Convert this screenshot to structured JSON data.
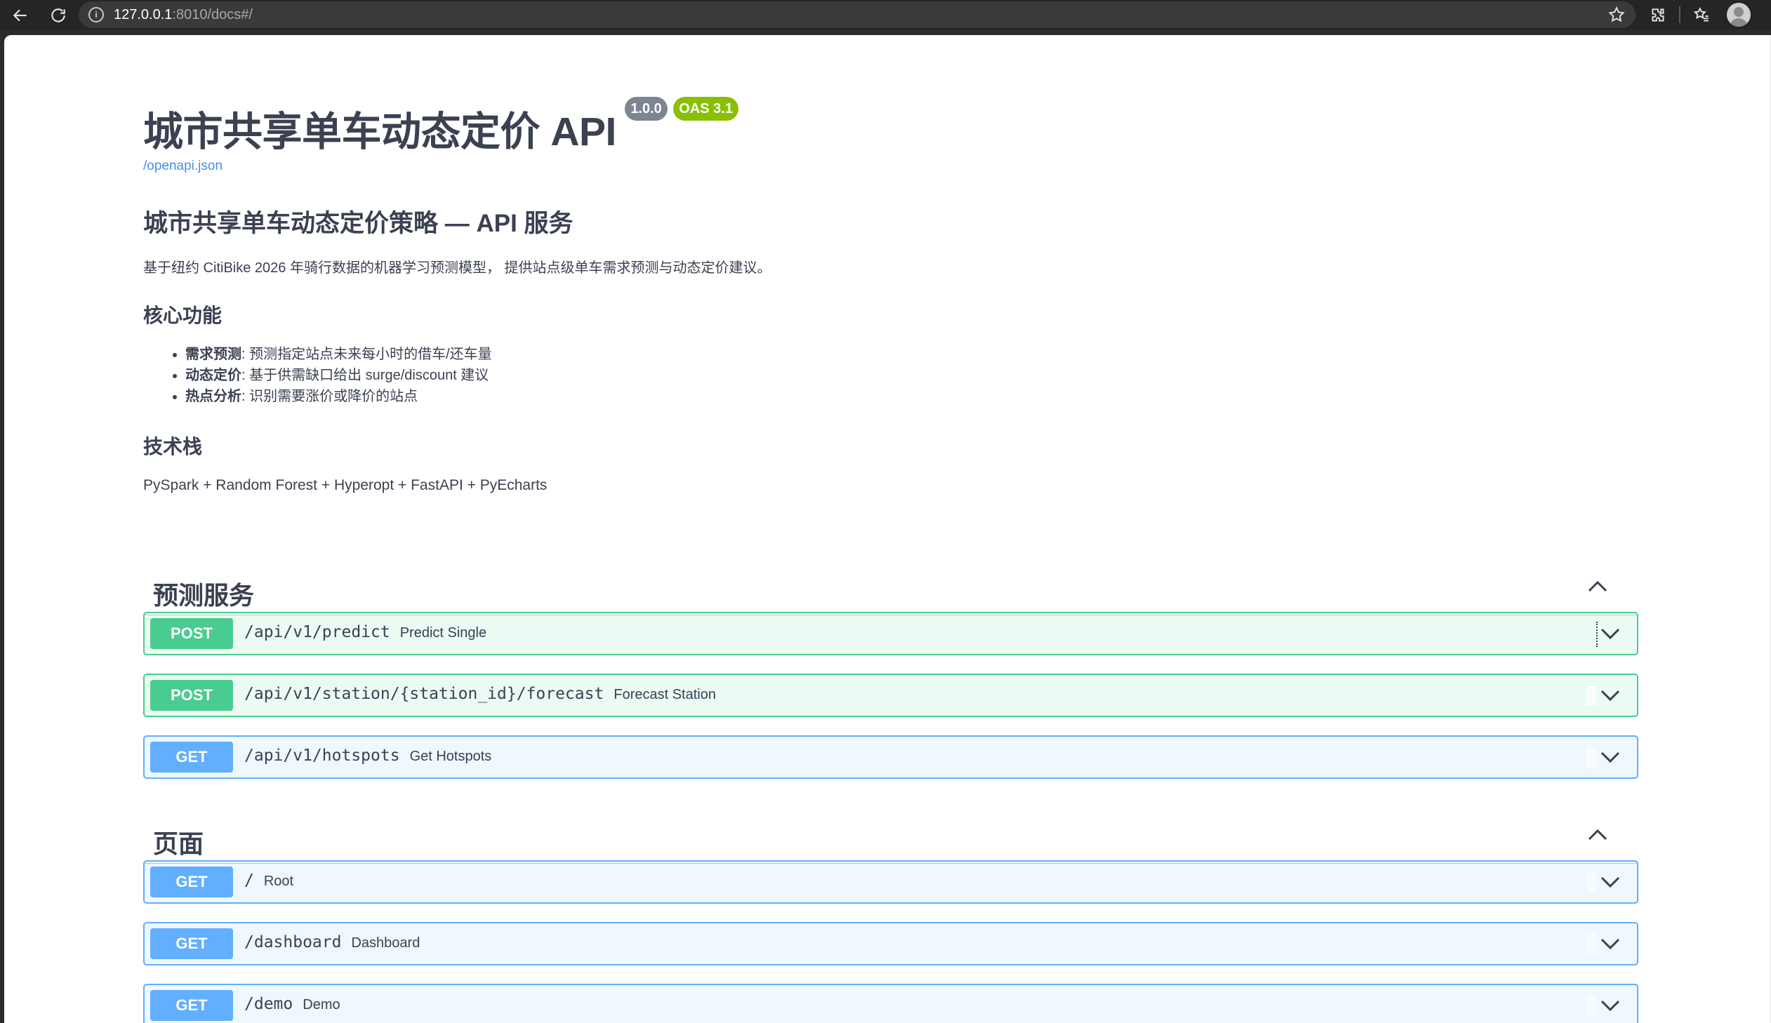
{
  "browser": {
    "url_host": "127.0.0.1",
    "url_path": ":8010/docs#/"
  },
  "info": {
    "title": "城市共享单车动态定价 API",
    "version": "1.0.0",
    "oas": "OAS 3.1",
    "openapi_link": "/openapi.json"
  },
  "description": {
    "heading": "城市共享单车动态定价策略 — API 服务",
    "intro": "基于纽约 CitiBike 2026 年骑行数据的机器学习预测模型， 提供站点级单车需求预测与动态定价建议。",
    "features_heading": "核心功能",
    "features": [
      {
        "name": "需求预测",
        "text": ": 预测指定站点未来每小时的借车/还车量"
      },
      {
        "name": "动态定价",
        "text": ": 基于供需缺口给出 surge/discount 建议"
      },
      {
        "name": "热点分析",
        "text": ": 识别需要涨价或降价的站点"
      }
    ],
    "tech_heading": "技术栈",
    "tech": "PySpark + Random Forest + Hyperopt + FastAPI + PyEcharts"
  },
  "tags": [
    {
      "name": "预测服务",
      "operations": [
        {
          "method": "POST",
          "path": "/api/v1/predict",
          "summary": "Predict Single"
        },
        {
          "method": "POST",
          "path": "/api/v1/station/{station_id}/forecast",
          "summary": "Forecast Station"
        },
        {
          "method": "GET",
          "path": "/api/v1/hotspots",
          "summary": "Get Hotspots"
        }
      ]
    },
    {
      "name": "页面",
      "operations": [
        {
          "method": "GET",
          "path": "/",
          "summary": "Root"
        },
        {
          "method": "GET",
          "path": "/dashboard",
          "summary": "Dashboard"
        },
        {
          "method": "GET",
          "path": "/demo",
          "summary": "Demo"
        }
      ]
    }
  ],
  "colors": {
    "post": "#49cc90",
    "get": "#61affe",
    "version_badge": "#7d8492",
    "oas_badge": "#89bf04",
    "text": "#3b4151",
    "link": "#4990e2"
  },
  "icons": {
    "back": "arrow-left-icon",
    "reload": "reload-icon",
    "info": "info-icon",
    "bookmark": "star-icon",
    "extensions": "puzzle-icon",
    "reading_list": "reading-list-icon",
    "profile": "avatar-icon",
    "collapse": "chevron-up-icon",
    "expand": "chevron-down-icon"
  }
}
